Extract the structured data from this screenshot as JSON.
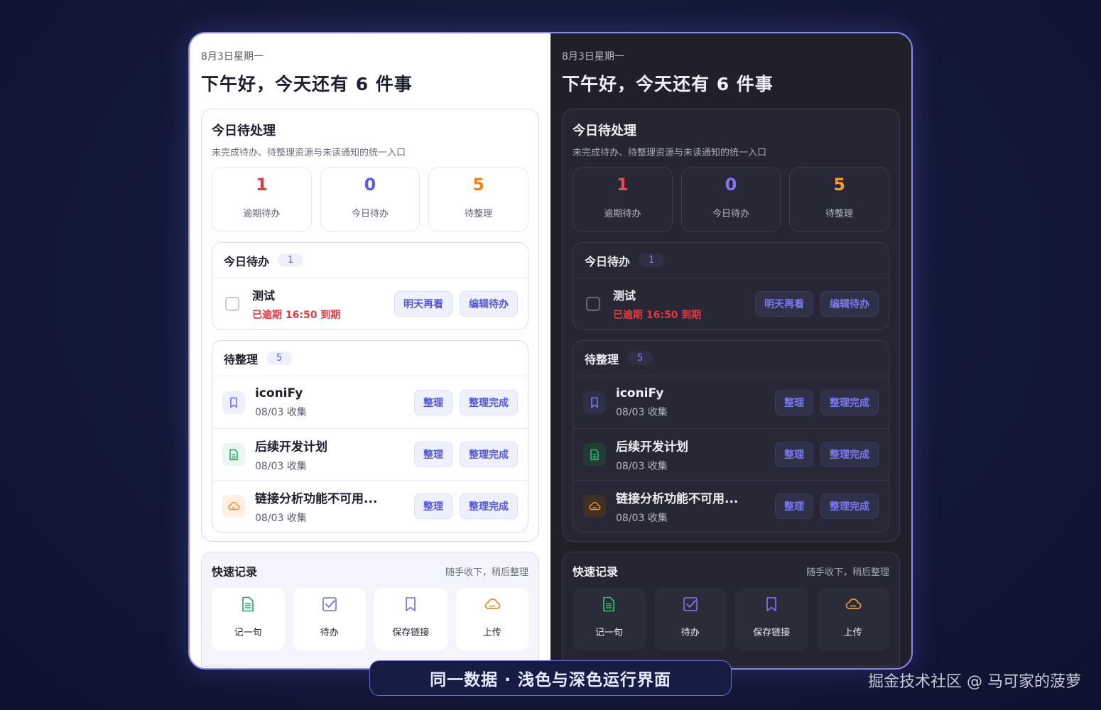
{
  "date": "8月3日星期一",
  "greeting": "下午好，今天还有 6 件事",
  "inbox": {
    "title": "今日待处理",
    "subtitle": "未完成待办、待整理资源与未读通知的统一入口",
    "stats": [
      {
        "value": "1",
        "label": "逾期待办",
        "color": "#e8373f"
      },
      {
        "value": "0",
        "label": "今日待办",
        "color": "#5b5fe0"
      },
      {
        "value": "5",
        "label": "待整理",
        "color": "#f0861a"
      }
    ]
  },
  "today_todos": {
    "title": "今日待办",
    "count": "1",
    "items": [
      {
        "title": "测试",
        "due": "已逾期  16:50  到期",
        "btn_later": "明天再看",
        "btn_edit": "编辑待办"
      }
    ]
  },
  "to_organize": {
    "title": "待整理",
    "count": "5",
    "items": [
      {
        "title": "iconiFy",
        "meta": "08/03 收集",
        "icon": "bookmark-icon",
        "btn_organize": "整理",
        "btn_done": "整理完成"
      },
      {
        "title": "后续开发计划",
        "meta": "08/03 收集",
        "icon": "document-icon",
        "btn_organize": "整理",
        "btn_done": "整理完成"
      },
      {
        "title": "链接分析功能不可用...",
        "meta": "08/03 收集",
        "icon": "cloud-icon",
        "btn_organize": "整理",
        "btn_done": "整理完成"
      }
    ]
  },
  "quick": {
    "title": "快速记录",
    "hint": "随手收下，稍后整理",
    "items": [
      {
        "label": "记一句",
        "icon": "document-icon"
      },
      {
        "label": "待办",
        "icon": "checkbox-icon"
      },
      {
        "label": "保存链接",
        "icon": "bookmark-icon"
      },
      {
        "label": "上传",
        "icon": "cloud-upload-icon"
      }
    ]
  },
  "caption": "同一数据 · 浅色与深色运行界面",
  "watermark": "掘金技术社区 @ 马可家的菠萝",
  "colors": {
    "accent": "#5b5fe0",
    "danger": "#e8373f",
    "warning": "#f0861a",
    "success": "#22a566",
    "frame": "#8f86ee"
  }
}
